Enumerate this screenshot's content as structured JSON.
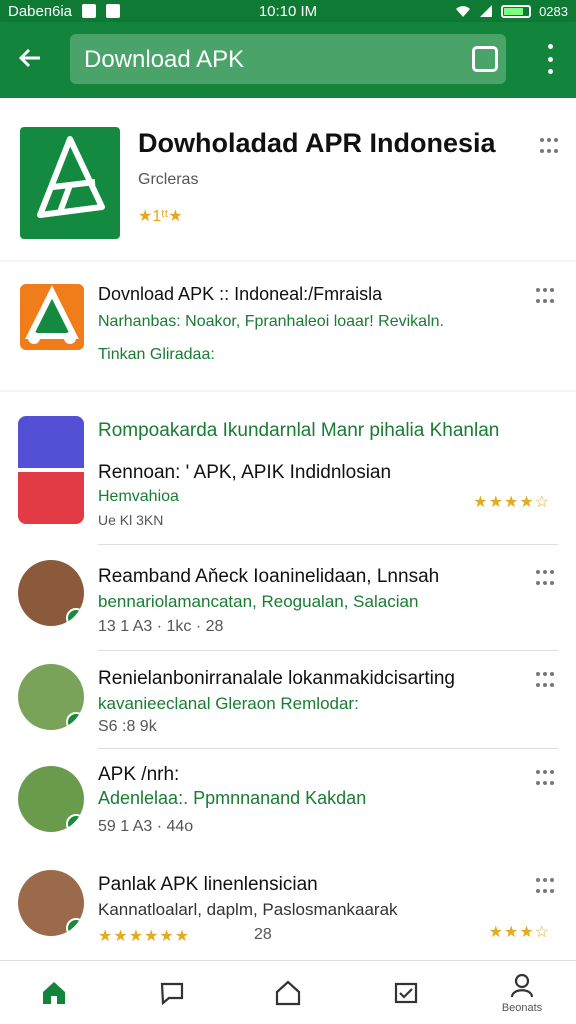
{
  "status_bar": {
    "carrier": "Dabeп6ia",
    "time": "10:10 IM",
    "battery": "0283",
    "battery_level": 0.8
  },
  "app_bar": {
    "search_value": "Download APK"
  },
  "hero": {
    "title": "Dowholadad APR Indonesia",
    "developer": "Grclerаs",
    "rating_text": "★1ᵗᵗ★"
  },
  "featured": {
    "title": "Dovnload APK :: Indoneal:/Fmraisla",
    "line1": "Narhanbas: Noakor, Fpranhaleoi loaar! Revikaln.",
    "line2": "Tinkan Gliradaa:"
  },
  "list": [
    {
      "title": "Rompoakarda Ikundarnlal Manr pihalia Khanlan",
      "subtitle": "Rennoan: ' APK, APIK Indidnlosian",
      "meta1": "Hemvahioa",
      "meta2": "Ue Kl 3KN",
      "stars": "★★★★☆"
    },
    {
      "title": "Reamband Aňeck Ioaninelidaan, Lnnsah",
      "subtitle": "bennariolamancatan, Reogualan, Salacian",
      "meta": "13 1 A3 · 1kc · 28"
    },
    {
      "title": "Renielanbonirranalale lokanmakidcisarting",
      "subtitle": "kavanieeclanal Gleraon Remlodar:",
      "meta": "S6 :8 9k"
    },
    {
      "title": "APK /nrh: ",
      "subtitle": "Adenlelaa:. Ppmnnanand Kakdan",
      "meta": "59 1 A3 · 44o"
    },
    {
      "title": "Panlak APK linenlensician",
      "subtitle": "Kannatloalarl, daplm, Paslosmankaarak",
      "meta_stars": "★★★★★★",
      "meta": "28",
      "right_stars": "★★★☆"
    }
  ],
  "bottom_nav": [
    {
      "icon": "home-icon"
    },
    {
      "icon": "chat-icon"
    },
    {
      "icon": "store-icon"
    },
    {
      "icon": "checkbox-icon"
    },
    {
      "icon": "profile-icon",
      "label": "Beonats"
    }
  ],
  "colors": {
    "primary": "#12843c",
    "accent": "#1a7b33",
    "star": "#e1ac1e"
  }
}
